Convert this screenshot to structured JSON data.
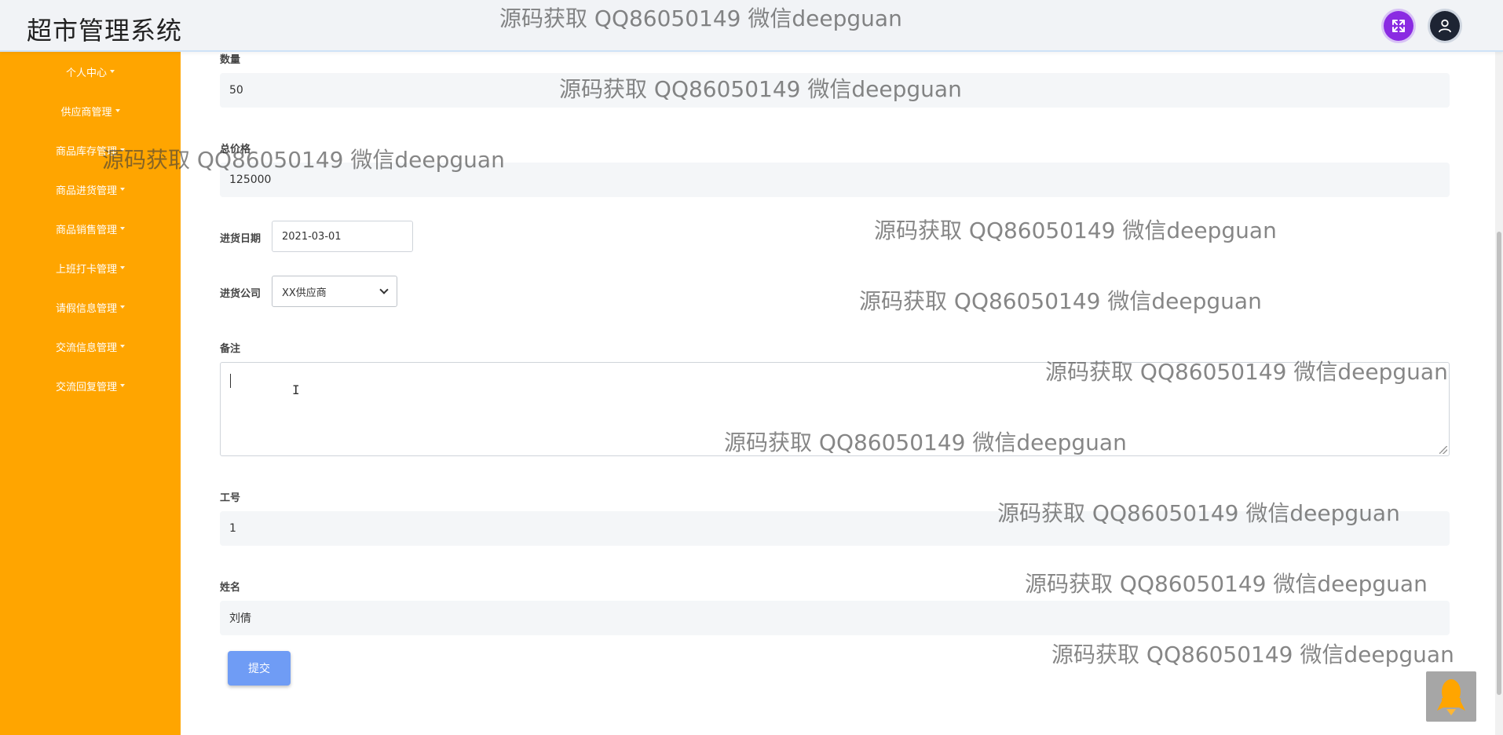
{
  "app": {
    "title": "超市管理系统"
  },
  "header": {
    "fullscreen_icon": "fullscreen-icon",
    "user_icon": "user-icon"
  },
  "sidebar": {
    "items": [
      {
        "label": "个人中心"
      },
      {
        "label": "供应商管理"
      },
      {
        "label": "商品库存管理"
      },
      {
        "label": "商品进货管理"
      },
      {
        "label": "商品销售管理"
      },
      {
        "label": "上班打卡管理"
      },
      {
        "label": "请假信息管理"
      },
      {
        "label": "交流信息管理"
      },
      {
        "label": "交流回复管理"
      }
    ]
  },
  "form": {
    "quantity": {
      "label": "数量",
      "value": "50"
    },
    "total_price": {
      "label": "总价格",
      "value": "125000"
    },
    "purchase_date": {
      "label": "进货日期",
      "value": "2021-03-01"
    },
    "supplier": {
      "label": "进货公司",
      "value": "XX供应商"
    },
    "remarks": {
      "label": "备注",
      "value": ""
    },
    "employee_id": {
      "label": "工号",
      "value": "1"
    },
    "name": {
      "label": "姓名",
      "value": "刘倩"
    },
    "submit_label": "提交"
  },
  "watermark": {
    "text": "源码获取 QQ86050149 微信deepguan"
  },
  "colors": {
    "sidebar": "#ffa500",
    "submit": "#6f9cf5",
    "fullscreen": "#8a2be2"
  }
}
